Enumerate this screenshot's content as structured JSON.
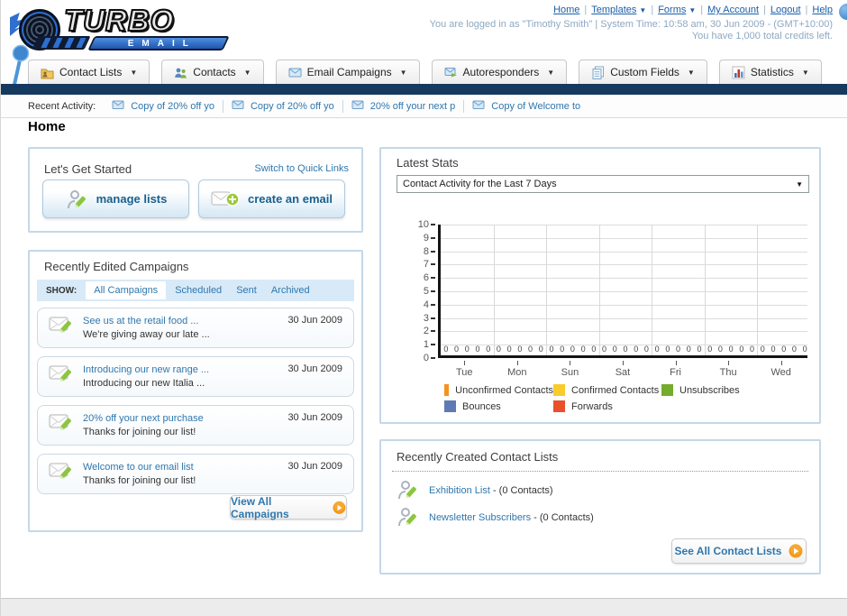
{
  "header": {
    "logo_primary": "TURBO",
    "logo_secondary": "EMAIL",
    "nav": [
      {
        "label": "Home",
        "dropdown": false
      },
      {
        "label": "Templates",
        "dropdown": true
      },
      {
        "label": "Forms",
        "dropdown": true
      },
      {
        "label": "My Account",
        "dropdown": false
      },
      {
        "label": "Logout",
        "dropdown": false
      },
      {
        "label": "Help",
        "dropdown": false
      }
    ],
    "login_info": "You are logged in as \"Timothy Smith\" | System Time: 10:58 am, 30 Jun 2009 - (GMT+10:00)",
    "credits_info": "You have 1,000 total credits left."
  },
  "main_tabs": [
    {
      "label": "Contact Lists",
      "icon": "contact-lists-icon"
    },
    {
      "label": "Contacts",
      "icon": "contacts-icon"
    },
    {
      "label": "Email Campaigns",
      "icon": "envelope-icon"
    },
    {
      "label": "Autoresponders",
      "icon": "envelope-arrow-icon"
    },
    {
      "label": "Custom Fields",
      "icon": "pages-icon"
    },
    {
      "label": "Statistics",
      "icon": "bar-chart-icon"
    }
  ],
  "recent_activity": {
    "label": "Recent Activity:",
    "items": [
      "Copy of 20% off yo",
      "Copy of 20% off yo",
      "20% off your next p",
      "Copy of Welcome to"
    ]
  },
  "page_title": "Home",
  "get_started": {
    "title": "Let's Get Started",
    "switch_link": "Switch to Quick Links",
    "buttons": [
      {
        "label": "manage lists",
        "icon": "person-pencil-icon"
      },
      {
        "label": "create an email",
        "icon": "envelope-plus-icon"
      }
    ]
  },
  "campaigns_panel": {
    "title": "Recently Edited Campaigns",
    "show_label": "SHOW:",
    "filters": [
      "All Campaigns",
      "Scheduled",
      "Sent",
      "Archived"
    ],
    "active_filter": "All Campaigns",
    "items": [
      {
        "title": "See us at the retail food ...",
        "subtitle": "We're giving away our late ...",
        "date": "30 Jun 2009"
      },
      {
        "title": "Introducing our new range ...",
        "subtitle": "Introducing our new Italia ...",
        "date": "30 Jun 2009"
      },
      {
        "title": "20% off your next purchase",
        "subtitle": "Thanks for joining our list!",
        "date": "30 Jun 2009"
      },
      {
        "title": "Welcome to our email list",
        "subtitle": "Thanks for joining our list!",
        "date": "30 Jun 2009"
      }
    ],
    "view_all_label": "View All Campaigns"
  },
  "stats_panel": {
    "title": "Latest Stats",
    "dropdown_value": "Contact Activity for the Last 7 Days",
    "chart_data": {
      "type": "bar",
      "title": "Contact Activity for the Last 7 Days",
      "categories": [
        "Tue",
        "Mon",
        "Sun",
        "Sat",
        "Fri",
        "Thu",
        "Wed"
      ],
      "series": [
        {
          "name": "Unconfirmed Contacts",
          "color": "#F6921E",
          "values": [
            0,
            0,
            0,
            0,
            0,
            0,
            0
          ]
        },
        {
          "name": "Confirmed Contacts",
          "color": "#F9CB2D",
          "values": [
            0,
            0,
            0,
            0,
            0,
            0,
            0
          ]
        },
        {
          "name": "Unsubscribes",
          "color": "#74AC2C",
          "values": [
            0,
            0,
            0,
            0,
            0,
            0,
            0
          ]
        },
        {
          "name": "Bounces",
          "color": "#5F79B5",
          "values": [
            0,
            0,
            0,
            0,
            0,
            0,
            0
          ]
        },
        {
          "name": "Forwards",
          "color": "#E8512C",
          "values": [
            0,
            0,
            0,
            0,
            0,
            0,
            0
          ]
        }
      ],
      "ylim": [
        0,
        10
      ],
      "yticks": [
        0,
        1,
        2,
        3,
        4,
        5,
        6,
        7,
        8,
        9,
        10
      ],
      "grid": true,
      "legend_position": "bottom",
      "data_labels_shown": true
    }
  },
  "contact_lists_panel": {
    "title": "Recently Created Contact Lists",
    "items": [
      {
        "name": "Exhibition List",
        "detail": "- (0 Contacts)"
      },
      {
        "name": "Newsletter Subscribers",
        "detail": "- (0 Contacts)"
      }
    ],
    "see_all_label": "See All Contact Lists"
  }
}
